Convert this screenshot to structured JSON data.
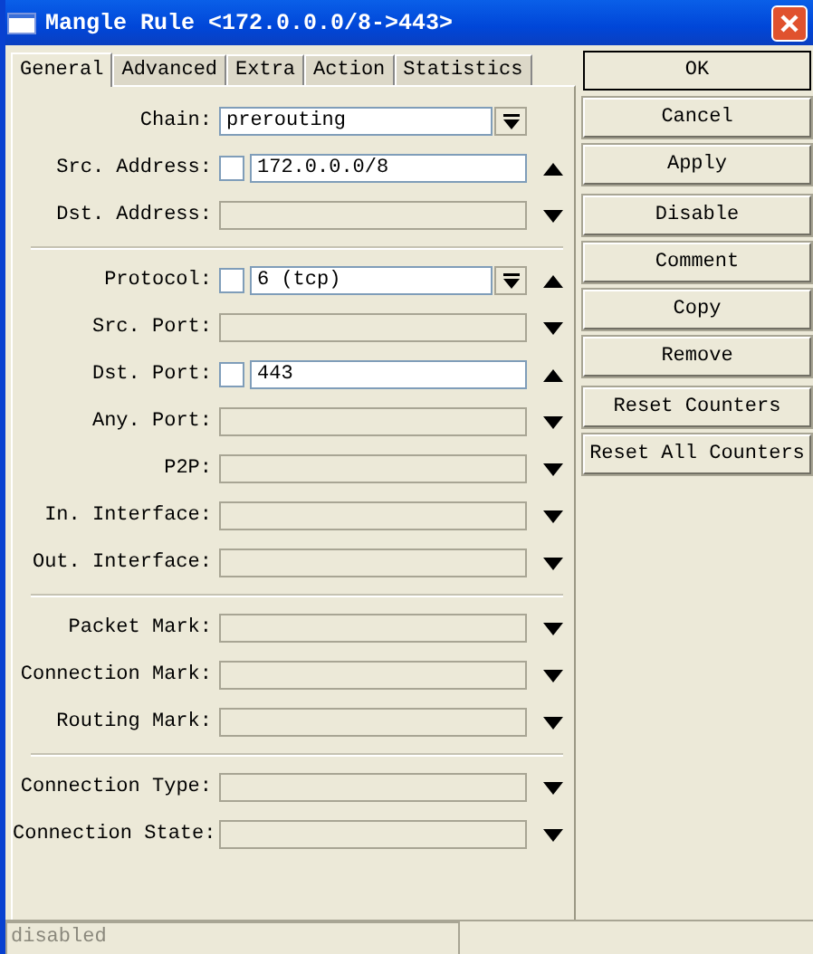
{
  "window": {
    "title": "Mangle Rule <172.0.0.0/8->443>"
  },
  "tabs": [
    {
      "label": "General",
      "selected": true
    },
    {
      "label": "Advanced",
      "selected": false
    },
    {
      "label": "Extra",
      "selected": false
    },
    {
      "label": "Action",
      "selected": false
    },
    {
      "label": "Statistics",
      "selected": false
    }
  ],
  "field_groups": [
    [
      {
        "label": "Chain:",
        "kind": "fixed",
        "value": "prerouting",
        "dropdown": true
      },
      {
        "label": "Src. Address:",
        "kind": "set",
        "negated": false,
        "value": "172.0.0.0/8",
        "dropdown": false
      },
      {
        "label": "Dst. Address:",
        "kind": "unset"
      }
    ],
    [
      {
        "label": "Protocol:",
        "kind": "set",
        "negated": false,
        "value": "6 (tcp)",
        "dropdown": true
      },
      {
        "label": "Src. Port:",
        "kind": "unset"
      },
      {
        "label": "Dst. Port:",
        "kind": "set",
        "negated": false,
        "value": "443",
        "dropdown": false
      },
      {
        "label": "Any. Port:",
        "kind": "unset"
      },
      {
        "label": "P2P:",
        "kind": "unset"
      },
      {
        "label": "In. Interface:",
        "kind": "unset"
      },
      {
        "label": "Out. Interface:",
        "kind": "unset"
      }
    ],
    [
      {
        "label": "Packet Mark:",
        "kind": "unset"
      },
      {
        "label": "Connection Mark:",
        "kind": "unset"
      },
      {
        "label": "Routing Mark:",
        "kind": "unset"
      }
    ],
    [
      {
        "label": "Connection Type:",
        "kind": "unset"
      },
      {
        "label": "Connection State:",
        "kind": "unset"
      }
    ]
  ],
  "button_groups": [
    [
      {
        "label": "OK",
        "default": true
      },
      {
        "label": "Cancel",
        "default": false
      },
      {
        "label": "Apply",
        "default": false
      }
    ],
    [
      {
        "label": "Disable",
        "default": false
      },
      {
        "label": "Comment",
        "default": false
      },
      {
        "label": "Copy",
        "default": false
      },
      {
        "label": "Remove",
        "default": false
      }
    ],
    [
      {
        "label": "Reset Counters",
        "default": false
      },
      {
        "label": "Reset All Counters",
        "default": false
      }
    ]
  ],
  "status_bar": {
    "text": "disabled"
  }
}
